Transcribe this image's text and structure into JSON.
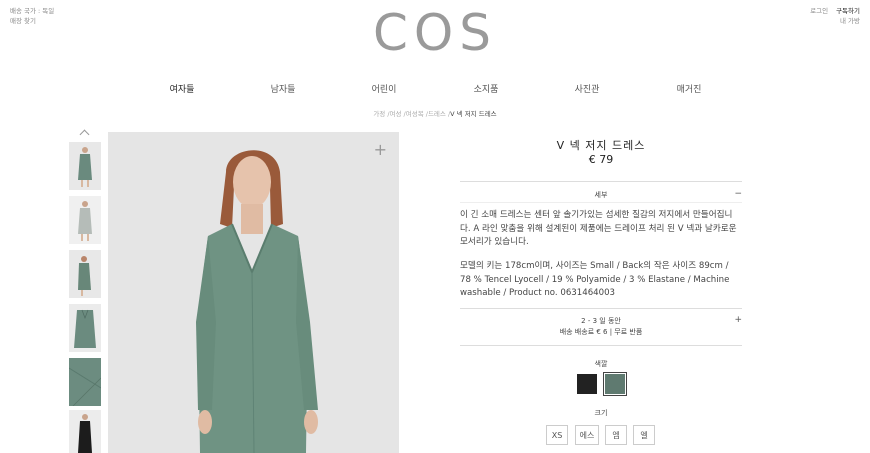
{
  "top_left": {
    "shipping": "배송 국가 : 독일",
    "stores": "매장 찾기"
  },
  "top_right": {
    "login": "로그인",
    "subscribe": "구독하기",
    "bag": "내 가방"
  },
  "logo": "COS",
  "nav": [
    "여자들",
    "남자들",
    "어린이",
    "소지품",
    "사진관",
    "매거진"
  ],
  "breadcrumb": {
    "path": "가정 /여성 /여성복 /드레스 /",
    "current": "V 넥 저지 드레스"
  },
  "product": {
    "title": "V 넥 저지 드레스",
    "price": "€ 79",
    "details_label": "세부",
    "details_toggle": "−",
    "description": "이 긴 소매 드레스는 센터 앞 솔기가있는 섬세한 질감의 저지에서 만들어집니다. A 라인 맞춤을 위해 설계된이 제품에는 드레이프 처리 된 V 넥과 날카로운 모서리가 있습니다.",
    "specs": "모델의 키는 178cm이며, 사이즈는 Small / Back의 작은 사이즈 89cm / 78 % Tencel Lyocell / 19 % Polyamide / 3 % Elastane / Machine washable / Product no. 0631464003",
    "shipping_time": "2 - 3 일 동안",
    "shipping_cost": "배송 배송료 € 6 | 무료 반품",
    "shipping_toggle": "+",
    "color_label": "색깔",
    "colors": [
      "#222222",
      "#5f7a70"
    ],
    "size_label": "크기",
    "sizes": [
      "XS",
      "에스",
      "엠",
      "엘"
    ]
  },
  "zoom_icon": "+"
}
